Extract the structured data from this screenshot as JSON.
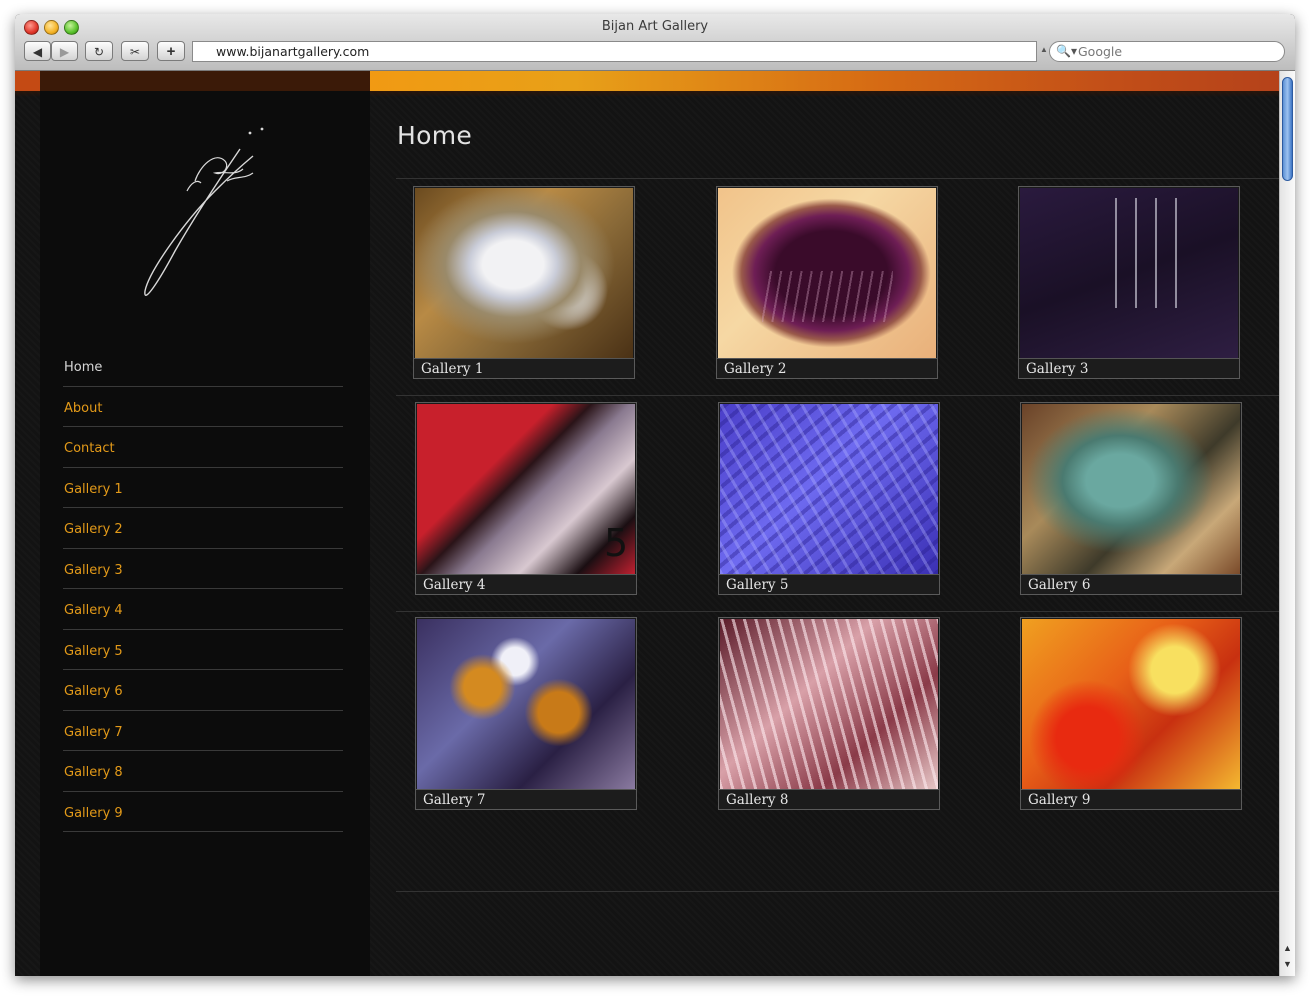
{
  "window": {
    "title": "Bijan Art Gallery"
  },
  "toolbar": {
    "back_label": "◀",
    "forward_label": "▶",
    "reload_label": "↻",
    "snip_label": "✂",
    "add_label": "+",
    "url": "www.bijanartgallery.com",
    "search_placeholder": "Google"
  },
  "page": {
    "title": "Home"
  },
  "nav": {
    "items": [
      {
        "label": "Home"
      },
      {
        "label": "About"
      },
      {
        "label": "Contact"
      },
      {
        "label": "Gallery 1"
      },
      {
        "label": "Gallery 2"
      },
      {
        "label": "Gallery 3"
      },
      {
        "label": "Gallery 4"
      },
      {
        "label": "Gallery 5"
      },
      {
        "label": "Gallery 6"
      },
      {
        "label": "Gallery 7"
      },
      {
        "label": "Gallery 8"
      },
      {
        "label": "Gallery 9"
      }
    ],
    "active_color": "#d6d6d6",
    "link_color": "#e39a19"
  },
  "galleries": [
    {
      "label": "Gallery 1"
    },
    {
      "label": "Gallery 2"
    },
    {
      "label": "Gallery 3"
    },
    {
      "label": "Gallery 4"
    },
    {
      "label": "Gallery 5"
    },
    {
      "label": "Gallery 6"
    },
    {
      "label": "Gallery 7"
    },
    {
      "label": "Gallery 8"
    },
    {
      "label": "Gallery 9"
    }
  ]
}
